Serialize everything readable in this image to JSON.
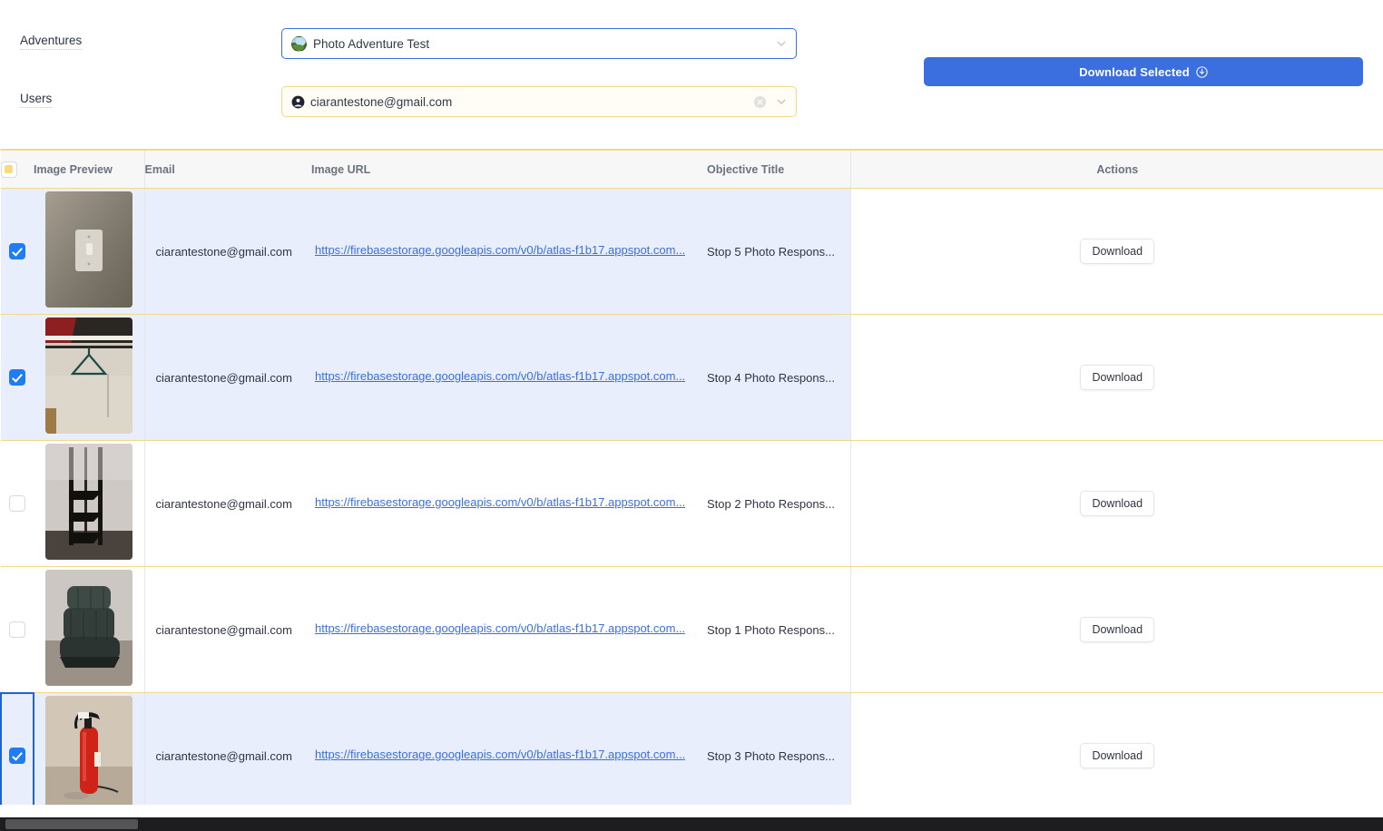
{
  "filters": {
    "adventures": {
      "label": "Adventures",
      "value": "Photo Adventure Test",
      "icon": "adventure-thumbnail-icon",
      "chevron": "chevron-down-icon"
    },
    "users": {
      "label": "Users",
      "value": "ciarantestone@gmail.com",
      "icon": "person-icon",
      "clear_icon": "clear-circle-icon",
      "chevron": "chevron-down-icon"
    }
  },
  "toolbar": {
    "download_selected_label": "Download Selected",
    "download_selected_icon": "download-circle-icon",
    "accent_color": "#3b6fe0"
  },
  "table": {
    "select_all_state": "indeterminate",
    "columns": [
      "Image Preview",
      "Email",
      "Image URL",
      "Objective Title",
      "Actions"
    ],
    "action_label": "Download",
    "rows": [
      {
        "selected": true,
        "focused": false,
        "preview": "light-switch-photo",
        "email": "ciarantestone@gmail.com",
        "url": "https://firebasestorage.googleapis.com/v0/b/atlas-f1b17.appspot.com...",
        "objective": "Stop 5 Photo Respons...",
        "action": "Download"
      },
      {
        "selected": true,
        "focused": false,
        "preview": "clothes-hanger-photo",
        "email": "ciarantestone@gmail.com",
        "url": "https://firebasestorage.googleapis.com/v0/b/atlas-f1b17.appspot.com...",
        "objective": "Stop 4 Photo Respons...",
        "action": "Download"
      },
      {
        "selected": false,
        "focused": false,
        "preview": "corner-shelf-photo",
        "email": "ciarantestone@gmail.com",
        "url": "https://firebasestorage.googleapis.com/v0/b/atlas-f1b17.appspot.com...",
        "objective": "Stop 2 Photo Respons...",
        "action": "Download"
      },
      {
        "selected": false,
        "focused": false,
        "preview": "office-chair-photo",
        "email": "ciarantestone@gmail.com",
        "url": "https://firebasestorage.googleapis.com/v0/b/atlas-f1b17.appspot.com...",
        "objective": "Stop 1 Photo Respons...",
        "action": "Download"
      },
      {
        "selected": true,
        "focused": true,
        "preview": "fire-extinguisher-photo",
        "email": "ciarantestone@gmail.com",
        "url": "https://firebasestorage.googleapis.com/v0/b/atlas-f1b17.appspot.com...",
        "objective": "Stop 3 Photo Respons...",
        "action": "Download"
      }
    ]
  },
  "colors": {
    "row_selected_bg": "#e8eefb",
    "row_border": "#f2d98a",
    "link": "#3b6fe0",
    "checkbox_checked": "#1f7cf2",
    "indeterminate_fill": "#f5dc82"
  }
}
